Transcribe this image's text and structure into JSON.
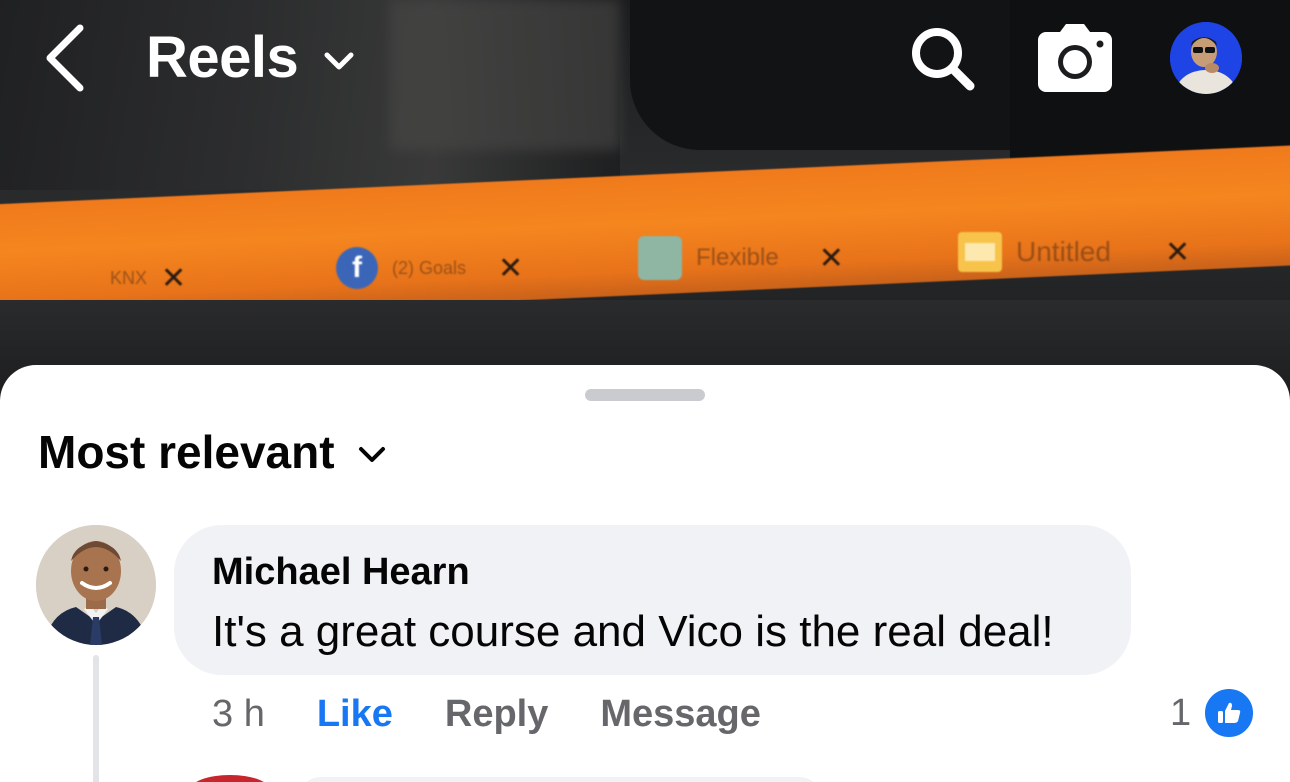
{
  "header": {
    "title": "Reels",
    "back_icon": "chevron-left-icon",
    "title_dropdown_icon": "chevron-down-icon",
    "search_icon": "search-icon",
    "camera_icon": "camera-icon",
    "profile_icon": "profile-avatar"
  },
  "video": {
    "tabs": [
      {
        "label": "KNX"
      },
      {
        "label": "(2) Goals"
      },
      {
        "label": "Flexible"
      },
      {
        "label": "Untitled"
      }
    ],
    "tab_bar_color": "#f5861f"
  },
  "comments": {
    "sort_label": "Most relevant",
    "sort_icon": "chevron-down-icon",
    "items": [
      {
        "author": "Michael Hearn",
        "text": "It's a great course and Vico is the real deal!",
        "time": "3 h",
        "like_label": "Like",
        "reply_label": "Reply",
        "message_label": "Message",
        "reaction_count": "1",
        "reaction_icon": "thumbs-up-icon"
      }
    ]
  },
  "colors": {
    "accent": "#1877f2",
    "bubble": "#f0f2f5",
    "secondary_text": "#65676b",
    "primary_text": "#050505"
  }
}
